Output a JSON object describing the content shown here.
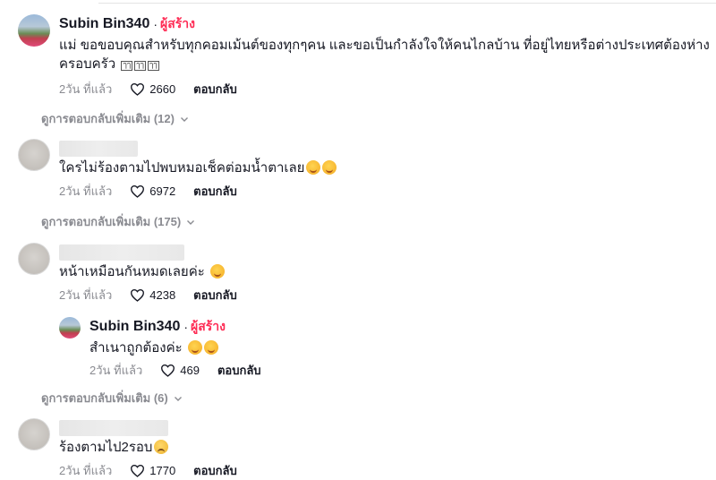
{
  "comments": [
    {
      "username": "Subin Bin340",
      "creator_badge": "ผู้สร้าง",
      "text": "แม่ ขอขอบคุณสำหรับทุกคอมเม้นต์ของทุกๆคน และขอเป็นกำลังใจให้คนไกลบ้าน ที่อยู่ไทยหรือต่างประเทศต้องห่างครอบครัว",
      "emoji_glyphs": [
        "ๅๅ",
        "ๅๅ",
        "ๅๅ"
      ],
      "time": "2วัน ที่แล้ว",
      "likes": "2660",
      "reply_label": "ตอบกลับ",
      "more_replies": "ดูการตอบกลับเพิ่มเติม (12)"
    },
    {
      "text": "ใครไม่ร้องตามไปพบหมอเช็คต่อมน้ำตาเลย",
      "time": "2วัน ที่แล้ว",
      "likes": "6972",
      "reply_label": "ตอบกลับ",
      "more_replies": "ดูการตอบกลับเพิ่มเติม (175)"
    },
    {
      "text": "หน้าเหมือนกันหมดเลยค่ะ",
      "time": "2วัน ที่แล้ว",
      "likes": "4238",
      "reply_label": "ตอบกลับ",
      "reply": {
        "username": "Subin Bin340",
        "creator_badge": "ผู้สร้าง",
        "text": "สำเนาถูกต้องค่ะ",
        "time": "2วัน ที่แล้ว",
        "likes": "469",
        "reply_label": "ตอบกลับ"
      },
      "more_replies": "ดูการตอบกลับเพิ่มเติม (6)"
    },
    {
      "text": "ร้องตามไป2รอบ",
      "time": "2วัน ที่แล้ว",
      "likes": "1770",
      "reply_label": "ตอบกลับ"
    }
  ],
  "colors": {
    "creator": "#fe2c55",
    "meta": "#8a8b91",
    "text": "#161823"
  }
}
